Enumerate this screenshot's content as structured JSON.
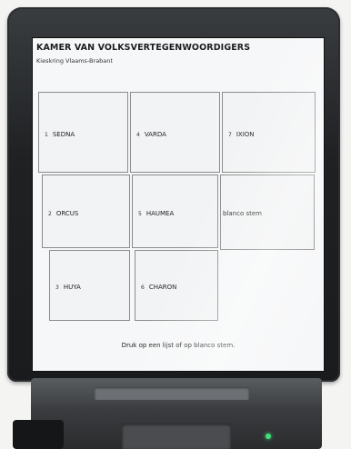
{
  "header": {
    "title": "KAMER VAN VOLKSVERTEGENWOORDIGERS",
    "subtitle": "Kieskring Vlaams-Brabant"
  },
  "lists": [
    {
      "number": "1",
      "name": "SEDNA"
    },
    {
      "number": "4",
      "name": "VARDA"
    },
    {
      "number": "7",
      "name": "IXION"
    },
    {
      "number": "2",
      "name": "ORCUS"
    },
    {
      "number": "5",
      "name": "HAUMEA"
    },
    {
      "number": "",
      "name": "blanco stem"
    },
    {
      "number": "3",
      "name": "HUYA"
    },
    {
      "number": "6",
      "name": "CHARON"
    }
  ],
  "footer": {
    "instruction": "Druk op een lijst of op blanco stem."
  },
  "colors": {
    "screen_bg": "#f6f7f8",
    "cell_border": "#8b8b8b",
    "indicator_led": "#44e07a"
  }
}
